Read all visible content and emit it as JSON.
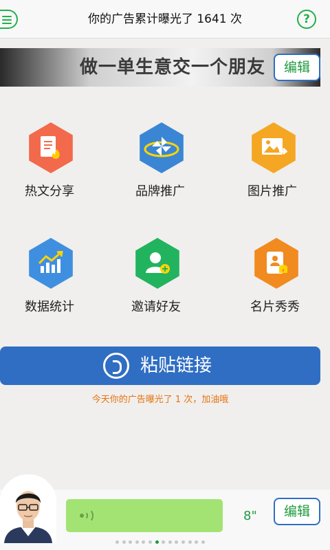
{
  "header": {
    "title": "你的广告累计曝光了  1641  次",
    "menu_icon": "menu-icon",
    "help_label": "?"
  },
  "banner": {
    "text": "做一单生意交一个朋友",
    "edit_label": "编辑"
  },
  "grid": {
    "items": [
      {
        "label": "热文分享",
        "icon": "hot-article-icon",
        "color": "#f26a4b"
      },
      {
        "label": "品牌推广",
        "icon": "pinwheel-icon",
        "color": "#3a86d4"
      },
      {
        "label": "图片推广",
        "icon": "picture-icon",
        "color": "#f5a623"
      },
      {
        "label": "数据统计",
        "icon": "chart-icon",
        "color": "#3f8fe0"
      },
      {
        "label": "邀请好友",
        "icon": "invite-user-icon",
        "color": "#22b35e"
      },
      {
        "label": "名片秀秀",
        "icon": "business-card-icon",
        "color": "#f18a1f"
      }
    ]
  },
  "paste": {
    "label": "粘贴链接",
    "color": "#2f6ec3"
  },
  "tip": {
    "text": "今天你的广告曝光了 1 次，加油哦"
  },
  "bottom": {
    "duration": "8\"",
    "edit_label": "编辑",
    "page_dots": 14,
    "active_dot": 6
  },
  "colors": {
    "accent_green": "#21b04b",
    "tip_orange": "#e6730e",
    "voice_green": "#a3e374"
  }
}
